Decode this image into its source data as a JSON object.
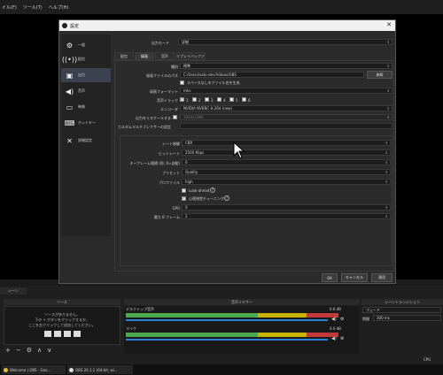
{
  "menubar": [
    "イル(F)",
    "ツール(T)",
    "ヘルプ(H)"
  ],
  "dialog": {
    "title": "設定",
    "nav": [
      {
        "icon": "gear-icon",
        "label": "一般"
      },
      {
        "icon": "stream-icon",
        "label": "配信"
      },
      {
        "icon": "output-icon",
        "label": "出力",
        "active": true
      },
      {
        "icon": "speaker-icon",
        "label": "音声"
      },
      {
        "icon": "monitor-icon",
        "label": "映像"
      },
      {
        "icon": "keyboard-icon",
        "label": "ホットキー"
      },
      {
        "icon": "tools-icon",
        "label": "詳細設定"
      }
    ],
    "output_mode": {
      "label": "出力モード",
      "value": "詳細"
    },
    "tabs": [
      "配信",
      "録画",
      "音声",
      "リプレイバッファ"
    ],
    "record": {
      "type_label": "種別",
      "type_value": "標準",
      "path_label": "録画ファイルのパス",
      "path_value": "C:/Users/sato-dev/Videos/OBS",
      "browse": "参照",
      "nospace_label": "スペースなしのファイル名を生成",
      "format_label": "録画フォーマット",
      "format_value": "mkv",
      "tracks_label": "音声トラック",
      "tracks": [
        "1",
        "2",
        "3",
        "4",
        "5",
        "6"
      ],
      "encoder_label": "エンコーダ",
      "encoder_value": "NVIDIA NVENC H.264 (new)",
      "rescale_label": "出力をリスケールする",
      "rescale_value": "1920x1080",
      "muxer_label": "カスタムマルチプレクサーの設定"
    },
    "encoder": {
      "rate_label": "レート制御",
      "rate_value": "CBR",
      "bitrate_label": "ビットレート",
      "bitrate_value": "2500 Kbps",
      "keyint_label": "キーフレーム間隔 (秒, 0=自動)",
      "keyint_value": "0",
      "preset_label": "プリセット",
      "preset_value": "Quality",
      "profile_label": "プロファイル",
      "profile_value": "high",
      "lookahead_label": "Look-ahead",
      "psycho_label": "心理視覚チューニング",
      "gpu_label": "GPU",
      "gpu_value": "0",
      "bframes_label": "最大 B フレーム",
      "bframes_value": "2"
    },
    "buttons": {
      "ok": "OK",
      "cancel": "キャンセル",
      "apply": "適用"
    }
  },
  "scenes_header": "シーン",
  "sources": {
    "header": "ソース",
    "empty_line1": "ソースがありません。",
    "empty_line2": "下の + ボタンをクリックするか、",
    "empty_line3": "ここを右クリックして追加してください。"
  },
  "mixer": {
    "header": "音声ミキサー",
    "channels": [
      {
        "name": "デスクトップ音声",
        "db": "0.0 dB",
        "level": 0.62
      },
      {
        "name": "マイク",
        "db": "0.0 dB",
        "level": 0.62
      }
    ]
  },
  "transitions": {
    "header": "シーントランジション",
    "type_value": "フェード",
    "duration_label": "期間",
    "duration_value": "300 ms"
  },
  "statusbar": {
    "cpu": "CPU"
  },
  "taskbar": [
    "Welcome | OBS - Goo...",
    "OBS 26.1.1 (64-bit, wi..."
  ],
  "colors": {
    "accent_nav": "#3c4150",
    "meter_green": "#4ea84e",
    "meter_yellow": "#c8b400",
    "meter_red": "#c23a3a",
    "volume_blue": "#2d7fd3"
  }
}
